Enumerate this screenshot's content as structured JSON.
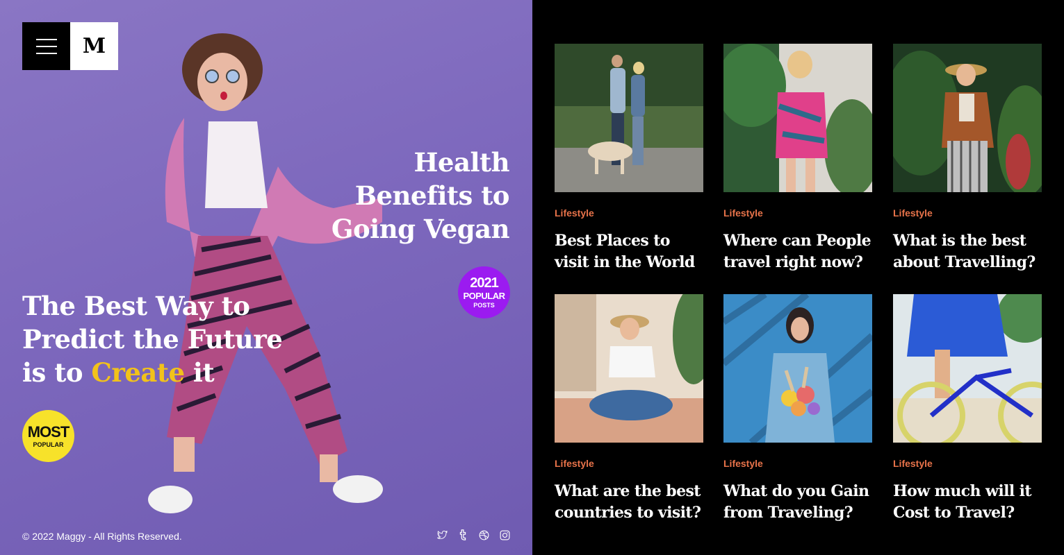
{
  "brand": {
    "letter": "M"
  },
  "hero": {
    "title_right": "Health Benefits to Going Vegan",
    "badge_2021": {
      "year": "2021",
      "line1": "POPULAR",
      "line2": "POSTS"
    },
    "title_left_prefix": "The Best Way to Predict the Future is to ",
    "title_left_highlight": "Create",
    "title_left_suffix": " it",
    "badge_most": {
      "line1": "MOST",
      "line2": "POPULAR"
    },
    "copyright": "© 2022 Maggy - All Rights Reserved.",
    "socials": [
      "twitter-icon",
      "tumblr-icon",
      "dribbble-icon",
      "instagram-icon"
    ]
  },
  "colors": {
    "hero_bg": "#7d68bd",
    "accent_yellow": "#f2c21a",
    "category": "#e8734a",
    "badge_purple": "#9b1bf0",
    "badge_yellow": "#f7e22a"
  },
  "posts": [
    {
      "category": "Lifestyle",
      "title": "Best Places to visit in the World"
    },
    {
      "category": "Lifestyle",
      "title": "Where can People travel right now?"
    },
    {
      "category": "Lifestyle",
      "title": "What is the best about Travelling?"
    },
    {
      "category": "Lifestyle",
      "title": "What are the best countries to visit?"
    },
    {
      "category": "Lifestyle",
      "title": "What do you Gain from Traveling?"
    },
    {
      "category": "Lifestyle",
      "title": "How much will it Cost to Travel?"
    }
  ]
}
